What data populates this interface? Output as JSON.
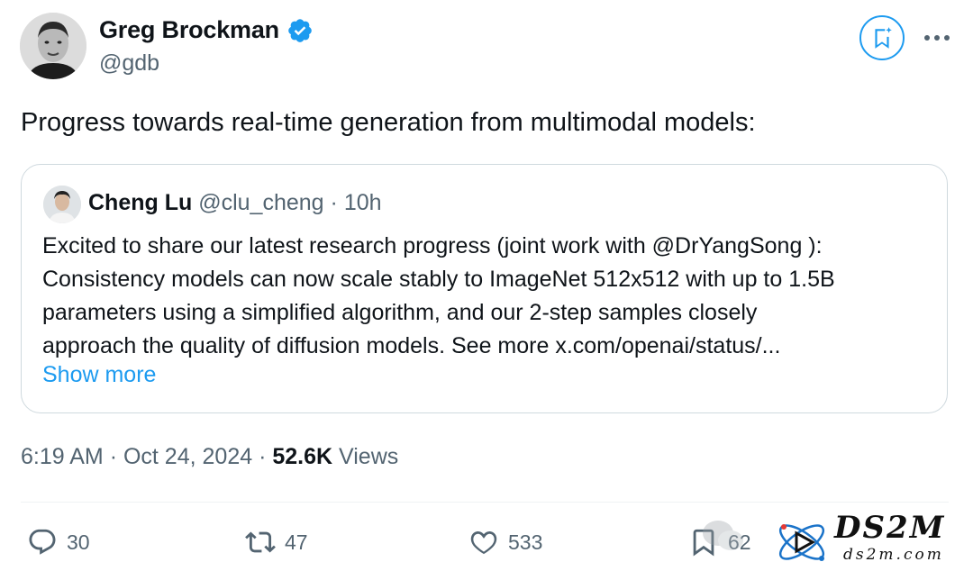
{
  "author": {
    "name": "Greg Brockman",
    "handle": "@gdb",
    "verified": true
  },
  "tweet": {
    "text": "Progress towards real-time generation from multimodal models:"
  },
  "quote": {
    "name": "Cheng Lu",
    "handle": "@clu_cheng",
    "separator": "·",
    "time": "10h",
    "lines": [
      "Excited to share our latest research progress (joint work with @DrYangSong ):",
      "Consistency models can now scale stably to ImageNet 512x512 with up to 1.5B",
      "parameters using a simplified algorithm, and our 2-step samples closely",
      "approach the quality of diffusion models. See more x.com/openai/status/..."
    ],
    "show_more": "Show more"
  },
  "meta": {
    "time": "6:19 AM",
    "sep1": "·",
    "date": "Oct 24, 2024",
    "sep2": "·",
    "views_count": "52.6K",
    "views_label": "Views"
  },
  "actions": {
    "replies": "30",
    "reposts": "47",
    "likes": "533",
    "bookmarks": "62"
  },
  "watermark": {
    "brand": "DS2M",
    "site": "ds2m.com"
  },
  "colors": {
    "accent": "#1d9bf0",
    "text": "#0f1419",
    "muted": "#536471",
    "border": "#cfd9de"
  }
}
